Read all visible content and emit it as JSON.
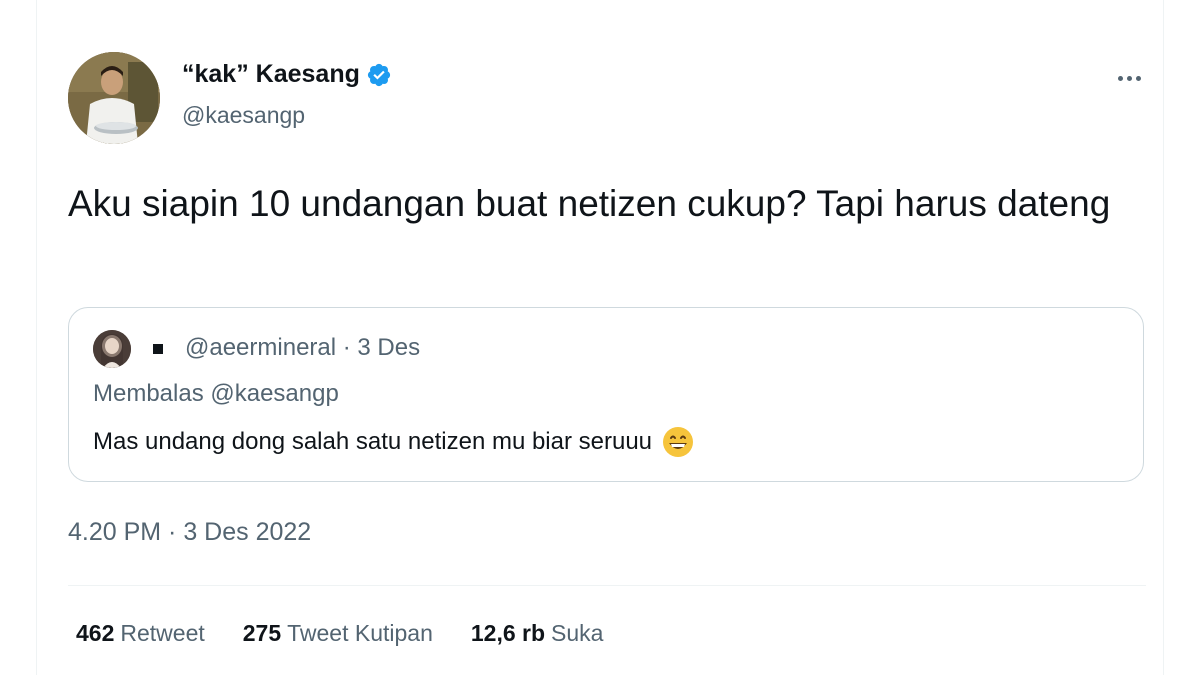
{
  "author": {
    "display_name": "“kak” Kaesang",
    "handle": "@kaesangp",
    "verified": true
  },
  "tweet": {
    "text": "Aku siapin 10 undangan buat netizen cukup? Tapi harus dateng",
    "timestamp": "4.20 PM · 3 Des 2022"
  },
  "quoted": {
    "meta": "@aeermineral · 3 Des",
    "reply_to": "Membalas @kaesangp",
    "text": "Mas undang dong salah satu netizen mu biar seruuu",
    "emoji": "grinning-face-emoji"
  },
  "stats": {
    "retweets": {
      "count": "462",
      "label": "Retweet"
    },
    "quotes": {
      "count": "275",
      "label": "Tweet Kutipan"
    },
    "likes": {
      "count": "12,6 rb",
      "label": "Suka"
    }
  },
  "colors": {
    "text": "#0f1419",
    "secondary": "#536471",
    "verified": "#1d9bf0",
    "border": "#cfd9de"
  }
}
